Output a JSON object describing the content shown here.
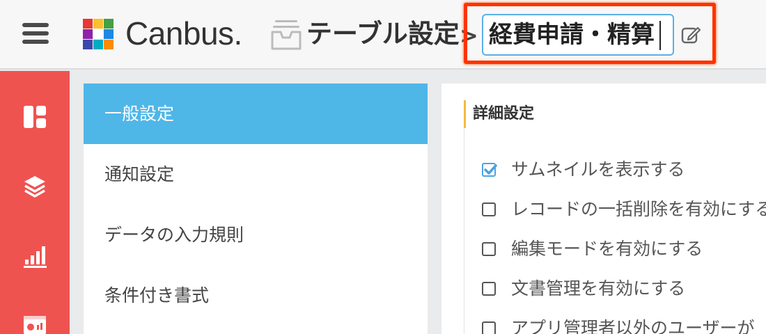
{
  "header": {
    "app_name": "Canbus.",
    "breadcrumb_root": "テーブル設定",
    "separator": ">",
    "table_name_value": "経費申請・精算"
  },
  "colors": {
    "rail": "#ef5350",
    "accent": "#4fb6e8",
    "highlight": "#ff3300",
    "title_bar": "#f5b942"
  },
  "rail": {
    "icons": [
      "dashboard-icon",
      "layers-icon",
      "bar-chart-icon",
      "report-icon"
    ]
  },
  "menu": {
    "items": [
      {
        "label": "一般設定",
        "active": true
      },
      {
        "label": "通知設定",
        "active": false
      },
      {
        "label": "データの入力規則",
        "active": false
      },
      {
        "label": "条件付き書式",
        "active": false
      }
    ]
  },
  "detail": {
    "title": "詳細設定",
    "options": [
      {
        "label": "サムネイルを表示する",
        "checked": true
      },
      {
        "label": "レコードの一括削除を有効にする",
        "checked": false
      },
      {
        "label": "編集モードを有効にする",
        "checked": false
      },
      {
        "label": "文書管理を有効にする",
        "checked": false
      },
      {
        "label": "アプリ管理者以外のユーザーが",
        "checked": false
      }
    ]
  }
}
